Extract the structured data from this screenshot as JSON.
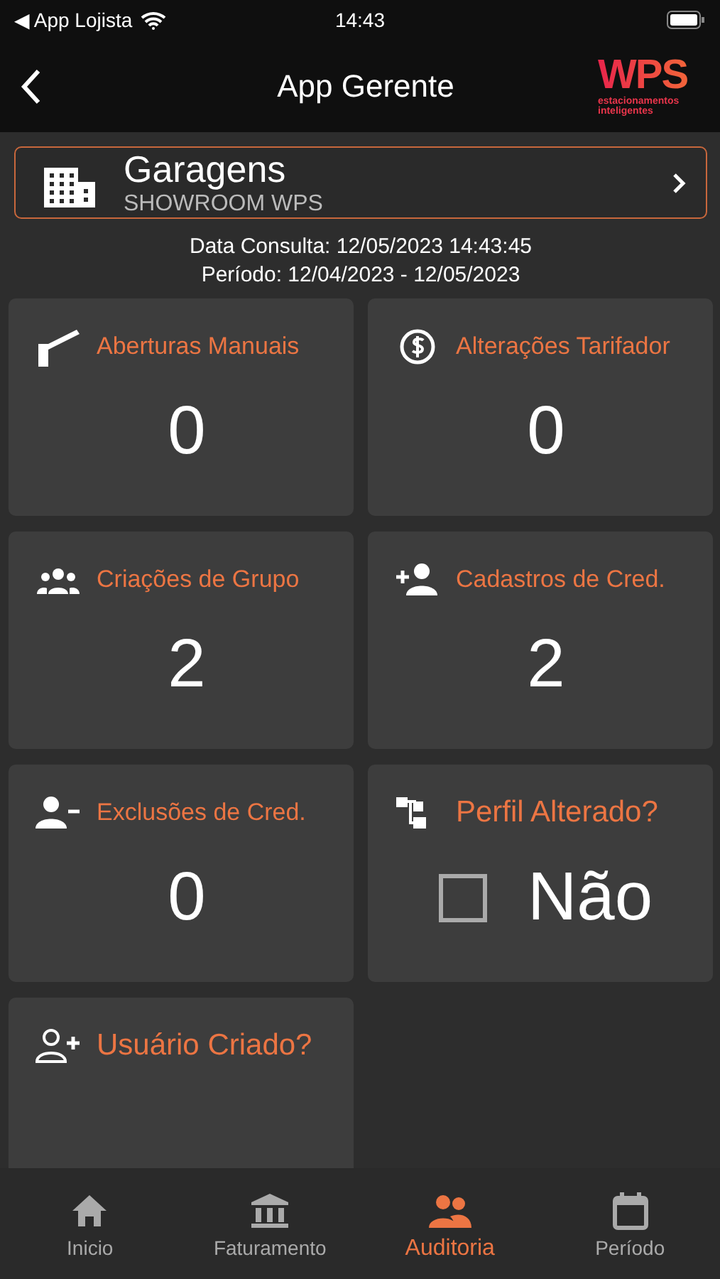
{
  "status_bar": {
    "back_app": "◀ App Lojista",
    "time": "14:43"
  },
  "header": {
    "title": "App Gerente",
    "logo": {
      "mark": "WPS",
      "tagline_1": "estacionamentos",
      "tagline_2": "inteligentes"
    }
  },
  "garage": {
    "title": "Garagens",
    "subtitle": "SHOWROOM WPS"
  },
  "info": {
    "consulta": "Data Consulta: 12/05/2023 14:43:45",
    "periodo": "Período: 12/04/2023 - 12/05/2023"
  },
  "cards": [
    {
      "kind": "count",
      "title": "Aberturas Manuais",
      "value": "0"
    },
    {
      "kind": "count",
      "title": "Alterações Tarifador",
      "value": "0"
    },
    {
      "kind": "count",
      "title": "Criações de Grupo",
      "value": "2"
    },
    {
      "kind": "count",
      "title": "Cadastros de Cred.",
      "value": "2"
    },
    {
      "kind": "count",
      "title": "Exclusões de Cred.",
      "value": "0"
    },
    {
      "kind": "flag",
      "title": "Perfil Alterado?",
      "value": "Não",
      "checked": false
    },
    {
      "kind": "flag",
      "title": "Usuário Criado?"
    }
  ],
  "tabs": [
    {
      "label": "Inicio",
      "selected": false
    },
    {
      "label": "Faturamento",
      "selected": false
    },
    {
      "label": "Auditoria",
      "selected": true
    },
    {
      "label": "Período",
      "selected": false
    }
  ]
}
